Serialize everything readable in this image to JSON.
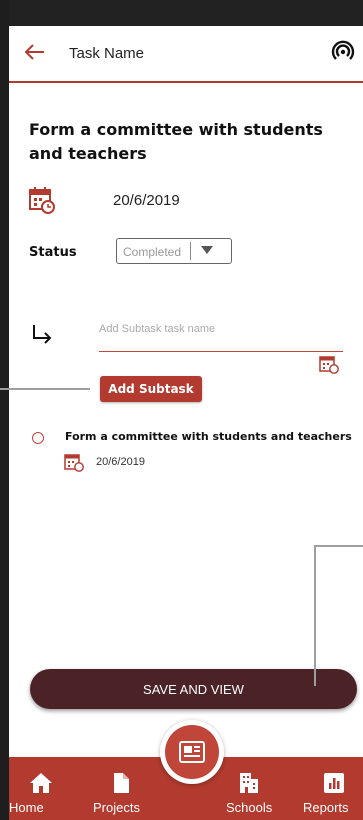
{
  "header": {
    "title": "Task Name"
  },
  "task": {
    "title": "Form a committee with students and teachers",
    "date": "20/6/2019",
    "status_label": "Status",
    "status_value": "Completed"
  },
  "subtask": {
    "placeholder": "Add Subtask task name",
    "add_button": "Add Subtask",
    "items": [
      {
        "title": "Form a committee with students and teachers",
        "date": "20/6/2019"
      }
    ]
  },
  "save_button": "SAVE AND VIEW",
  "nav": {
    "items": [
      {
        "label": "Home",
        "icon": "home-icon"
      },
      {
        "label": "Projects",
        "icon": "document-icon"
      },
      {
        "label": "Schools",
        "icon": "building-icon"
      },
      {
        "label": "Reports",
        "icon": "bar-chart-icon"
      }
    ]
  },
  "colors": {
    "accent": "#b23a2e",
    "save": "#4b2226"
  }
}
